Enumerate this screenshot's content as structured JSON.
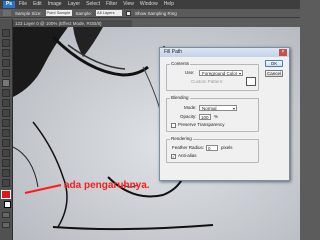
{
  "app": {
    "logo": "Ps"
  },
  "menu": [
    "File",
    "Edit",
    "Image",
    "Layer",
    "Select",
    "Filter",
    "View",
    "Window",
    "Help"
  ],
  "options_bar": {
    "sample_size_label": "Sample Size:",
    "sample_size_value": "Point Sample",
    "sample_label": "Sample:",
    "sample_value": "All Layers",
    "show_ring_label": "Show Sampling Ring"
  },
  "document_tab": {
    "title": "123 Layer 0 @ 100% (Effect Mode, RGB/8)"
  },
  "colors": {
    "foreground": "#e3161b",
    "background": "#ffffff",
    "callout": "#ff1a1a"
  },
  "callout": {
    "text": "ada pengaruhnya."
  },
  "dialog": {
    "title": "Fill Path",
    "ok_label": "OK",
    "cancel_label": "Cancel",
    "contents": {
      "legend": "Contents",
      "use_label": "Use:",
      "use_value": "Foreground Color",
      "custom_pattern_label": "Custom Pattern:"
    },
    "blending": {
      "legend": "Blending",
      "mode_label": "Mode:",
      "mode_value": "Normal",
      "opacity_label": "Opacity:",
      "opacity_value": "100",
      "opacity_unit": "%",
      "preserve_transparency_label": "Preserve Transparency"
    },
    "rendering": {
      "legend": "Rendering",
      "feather_label": "Feather Radius:",
      "feather_value": "0",
      "feather_unit": "pixels",
      "antialiased_label": "Anti-alias",
      "antialiased_checked": true
    }
  }
}
